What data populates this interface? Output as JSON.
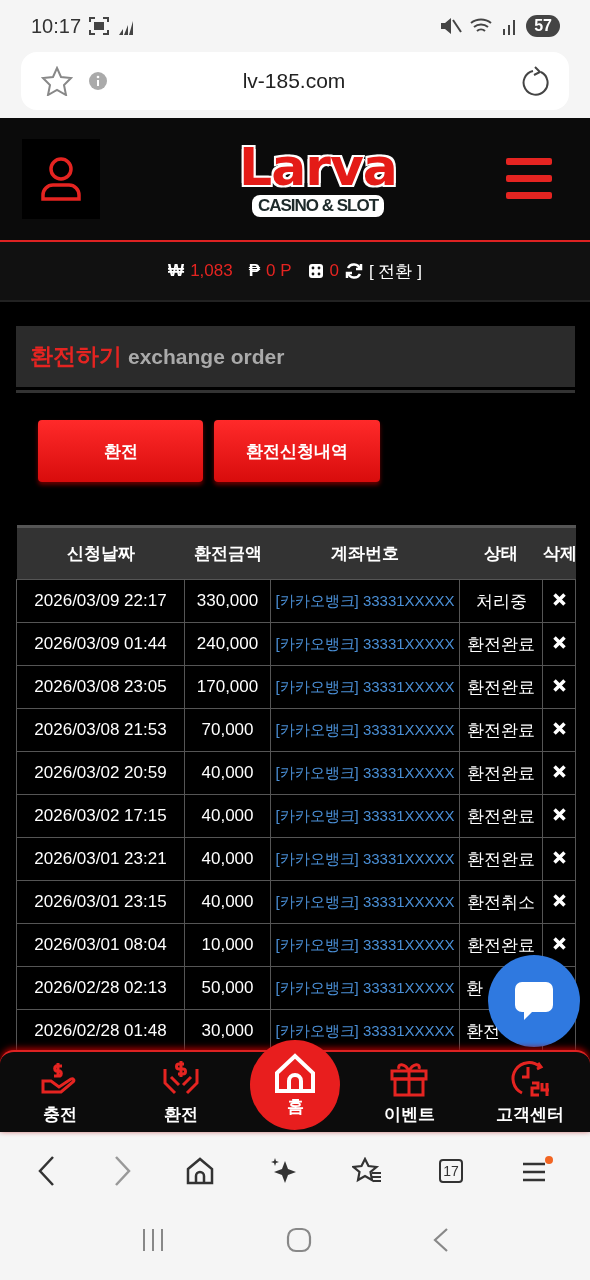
{
  "status_bar": {
    "time": "10:17",
    "battery": "57"
  },
  "browser": {
    "url": "lv-185.com",
    "tab_count": "17"
  },
  "header": {
    "logo": "Larva",
    "logo_subtitle": "CASINO & SLOT"
  },
  "balance": {
    "won_symbol": "₩",
    "money": "1,083",
    "point_symbol": "₱",
    "points": "0 P",
    "chips": "0",
    "convert": "[ 전환 ]"
  },
  "page_title": {
    "title": "환전하기",
    "subtitle": "exchange order"
  },
  "buttons": [
    {
      "label": "환전"
    },
    {
      "label": "환전신청내역"
    }
  ],
  "table": {
    "columns": [
      "신청날짜",
      "환전금액",
      "계좌번호",
      "상태",
      "삭제"
    ],
    "rows": [
      {
        "date": "2026/03/09 22:17",
        "amount": "330,000",
        "account": "[카카오뱅크] 33331XXXXX",
        "status": "처리중",
        "delete": true
      },
      {
        "date": "2026/03/09 01:44",
        "amount": "240,000",
        "account": "[카카오뱅크] 33331XXXXX",
        "status": "환전완료",
        "delete": true
      },
      {
        "date": "2026/03/08 23:05",
        "amount": "170,000",
        "account": "[카카오뱅크] 33331XXXXX",
        "status": "환전완료",
        "delete": true
      },
      {
        "date": "2026/03/08 21:53",
        "amount": "70,000",
        "account": "[카카오뱅크] 33331XXXXX",
        "status": "환전완료",
        "delete": true
      },
      {
        "date": "2026/03/02 20:59",
        "amount": "40,000",
        "account": "[카카오뱅크] 33331XXXXX",
        "status": "환전완료",
        "delete": true
      },
      {
        "date": "2026/03/02 17:15",
        "amount": "40,000",
        "account": "[카카오뱅크] 33331XXXXX",
        "status": "환전완료",
        "delete": true
      },
      {
        "date": "2026/03/01 23:21",
        "amount": "40,000",
        "account": "[카카오뱅크] 33331XXXXX",
        "status": "환전완료",
        "delete": true
      },
      {
        "date": "2026/03/01 23:15",
        "amount": "40,000",
        "account": "[카카오뱅크] 33331XXXXX",
        "status": "환전취소",
        "delete": true
      },
      {
        "date": "2026/03/01 08:04",
        "amount": "10,000",
        "account": "[카카오뱅크] 33331XXXXX",
        "status": "환전완료",
        "delete": true
      },
      {
        "date": "2026/02/28 02:13",
        "amount": "50,000",
        "account": "[카카오뱅크] 33331XXXXX",
        "status": "환",
        "delete": false
      },
      {
        "date": "2026/02/28 01:48",
        "amount": "30,000",
        "account": "[카카오뱅크] 33331XXXXX",
        "status": "환전",
        "delete": false
      }
    ]
  },
  "bottom_nav": [
    {
      "label": "충전",
      "kind": "charge"
    },
    {
      "label": "환전",
      "kind": "exchange"
    },
    {
      "label": "홈",
      "kind": "home"
    },
    {
      "label": "이벤트",
      "kind": "event"
    },
    {
      "label": "고객센터",
      "kind": "support"
    }
  ]
}
